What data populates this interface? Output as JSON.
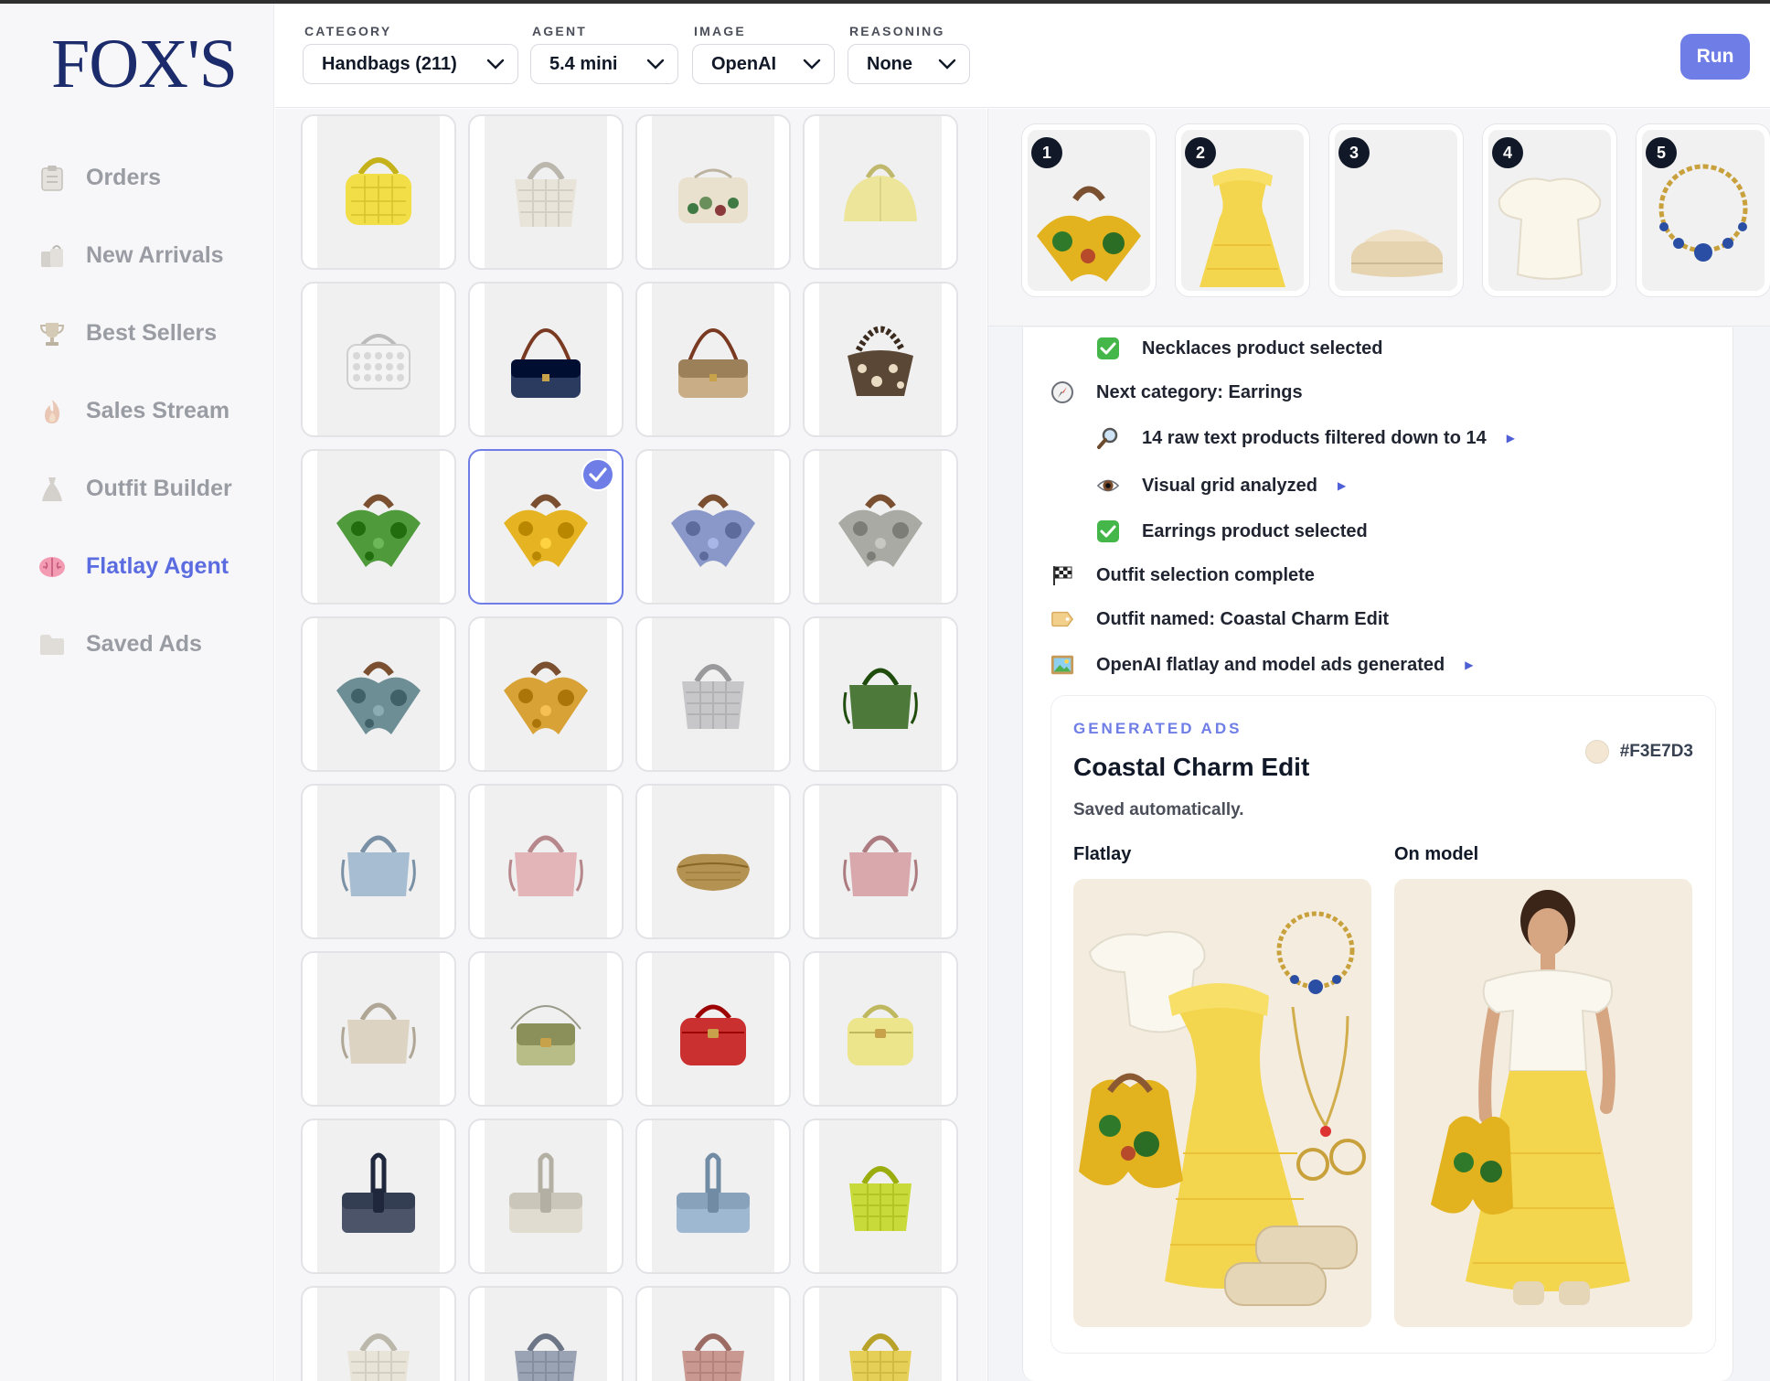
{
  "brand": {
    "logo_text": "FOX'S"
  },
  "sidebar": {
    "items": [
      {
        "label": "Orders",
        "icon": "clipboard-icon",
        "active": false
      },
      {
        "label": "New Arrivals",
        "icon": "shopping-bags-icon",
        "active": false
      },
      {
        "label": "Best Sellers",
        "icon": "trophy-icon",
        "active": false
      },
      {
        "label": "Sales Stream",
        "icon": "flame-icon",
        "active": false
      },
      {
        "label": "Outfit Builder",
        "icon": "dress-icon",
        "active": false
      },
      {
        "label": "Flatlay Agent",
        "icon": "brain-icon",
        "active": true
      },
      {
        "label": "Saved Ads",
        "icon": "folder-icon",
        "active": false
      }
    ]
  },
  "toolbar": {
    "category": {
      "label": "CATEGORY",
      "value": "Handbags (211)"
    },
    "agent": {
      "label": "AGENT",
      "value": "5.4 mini"
    },
    "image": {
      "label": "IMAGE",
      "value": "OpenAI"
    },
    "reasoning": {
      "label": "REASONING",
      "value": "None"
    },
    "run_label": "Run"
  },
  "products": [
    {
      "kind": "quilted-tote",
      "color": "#f2de46"
    },
    {
      "kind": "woven-tote",
      "color": "#e8e4da"
    },
    {
      "kind": "floral-clutch",
      "color": "#e9e0cd"
    },
    {
      "kind": "dome-bag",
      "color": "#ece59a"
    },
    {
      "kind": "sequin-bag",
      "color": "#f4f4f4"
    },
    {
      "kind": "shoulder-bag",
      "color": "#2a3b5f"
    },
    {
      "kind": "shoulder-bag",
      "color": "#c9ad86"
    },
    {
      "kind": "animal-hobo",
      "color": "#5b4736"
    },
    {
      "kind": "scarf-bag",
      "color": "#4f9a3a"
    },
    {
      "kind": "scarf-bag",
      "color": "#e6b423"
    },
    {
      "kind": "scarf-bag",
      "color": "#8a97c9"
    },
    {
      "kind": "scarf-bag",
      "color": "#a9aaa4"
    },
    {
      "kind": "scarf-bag",
      "color": "#6e8e95"
    },
    {
      "kind": "scarf-bag",
      "color": "#d9a236"
    },
    {
      "kind": "woven-tote",
      "color": "#c7c7c9"
    },
    {
      "kind": "structured-tote",
      "color": "#4d7a3b"
    },
    {
      "kind": "structured-tote",
      "color": "#a6bdd2"
    },
    {
      "kind": "structured-tote",
      "color": "#e3b4b8"
    },
    {
      "kind": "pouch-clutch",
      "color": "#b49352"
    },
    {
      "kind": "structured-tote",
      "color": "#d8a8ac"
    },
    {
      "kind": "structured-tote",
      "color": "#dcd3c2"
    },
    {
      "kind": "flap-crossbody",
      "color": "#b8bc86"
    },
    {
      "kind": "vanity-case",
      "color": "#c9302f"
    },
    {
      "kind": "vanity-case",
      "color": "#ece58c"
    },
    {
      "kind": "fold-clutch",
      "color": "#4b5468"
    },
    {
      "kind": "fold-clutch",
      "color": "#e0dcd0"
    },
    {
      "kind": "fold-clutch",
      "color": "#9fb8d2"
    },
    {
      "kind": "woven-tote",
      "color": "#c8da3a"
    },
    {
      "kind": "woven-tote",
      "color": "#e8e4d8"
    },
    {
      "kind": "woven-tote",
      "color": "#9aa3b3"
    },
    {
      "kind": "woven-tote",
      "color": "#c99890"
    },
    {
      "kind": "woven-tote",
      "color": "#e6cf57"
    }
  ],
  "selected_index": 9,
  "outfit": [
    {
      "number": "1",
      "item": "scarf-handbag"
    },
    {
      "number": "2",
      "item": "yellow-dress"
    },
    {
      "number": "3",
      "item": "platform-sandal"
    },
    {
      "number": "4",
      "item": "ruffle-top"
    },
    {
      "number": "5",
      "item": "charm-necklace"
    }
  ],
  "log": [
    {
      "icon": "check-icon",
      "text": "Necklaces product selected",
      "indent": true,
      "expand": false
    },
    {
      "icon": "compass-icon",
      "text": "Next category: Earrings",
      "indent": false,
      "expand": false
    },
    {
      "icon": "magnifier-icon",
      "text": "14 raw text products filtered down to 14",
      "indent": true,
      "expand": true
    },
    {
      "icon": "eye-icon",
      "text": "Visual grid analyzed",
      "indent": true,
      "expand": true
    },
    {
      "icon": "check-icon",
      "text": "Earrings product selected",
      "indent": true,
      "expand": false
    },
    {
      "icon": "checkered-flag-icon",
      "text": "Outfit selection complete",
      "indent": false,
      "expand": false
    },
    {
      "icon": "tag-icon",
      "text": "Outfit named: Coastal Charm Edit",
      "indent": false,
      "expand": false
    },
    {
      "icon": "picture-icon",
      "text": "OpenAI flatlay and model ads generated",
      "indent": false,
      "expand": true
    }
  ],
  "ads": {
    "eyebrow": "GENERATED ADS",
    "title": "Coastal Charm Edit",
    "saved": "Saved automatically.",
    "swatch_hex": "#F3E7D3",
    "flatlay_label": "Flatlay",
    "model_label": "On model"
  },
  "colors": {
    "accent": "#6f7ee6",
    "brand": "#1b2b6b"
  }
}
